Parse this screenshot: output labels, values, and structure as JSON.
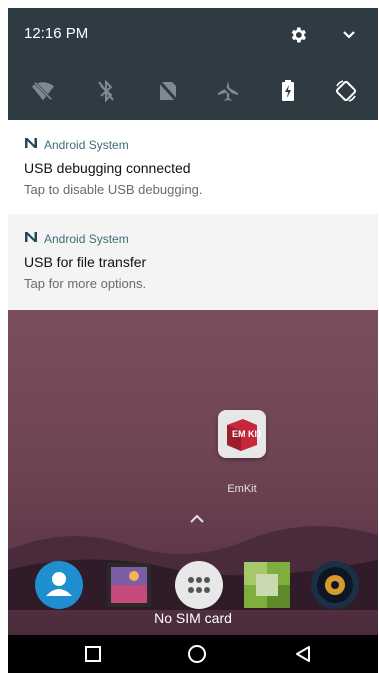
{
  "status": {
    "time": "12:16 PM"
  },
  "header_icons": [
    "gear-icon",
    "chevron-down-icon"
  ],
  "quick_settings": [
    "wifi-off-icon",
    "bluetooth-off-icon",
    "no-sim-icon",
    "airplane-mode-icon",
    "battery-charging-icon",
    "auto-rotate-icon"
  ],
  "notifications": [
    {
      "app": "Android System",
      "title": "USB debugging connected",
      "text": "Tap to disable USB debugging."
    },
    {
      "app": "Android System",
      "title": "USB for file transfer",
      "text": "Tap for more options."
    }
  ],
  "home": {
    "app_label": "EmKit",
    "app_icon_text": "EM KIT",
    "no_sim": "No SIM card",
    "dock": [
      "contacts-icon",
      "gallery-icon",
      "app-drawer-icon",
      "game-icon",
      "music-icon"
    ]
  },
  "navbar": [
    "recents-icon",
    "home-icon",
    "back-icon"
  ],
  "colors": {
    "shade": "#2e3b43",
    "app_name": "#3c6e74",
    "wallpaper": "#6d4352"
  }
}
